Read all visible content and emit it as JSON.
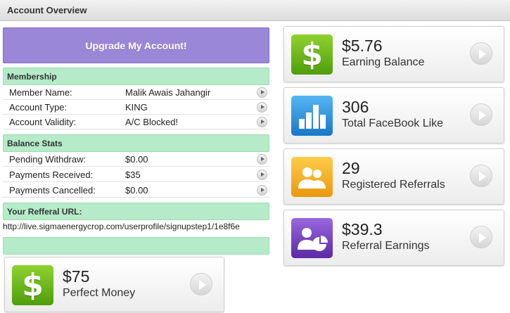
{
  "header": {
    "title": "Account Overview"
  },
  "upgrade_label": "Upgrade My Account!",
  "membership": {
    "heading": "Membership",
    "rows": [
      {
        "key": "Member Name:",
        "value": "Malik Awais Jahangir"
      },
      {
        "key": "Account Type:",
        "value": "KING"
      },
      {
        "key": "Account Validity:",
        "value": "A/C Blocked!"
      }
    ]
  },
  "balance": {
    "heading": "Balance Stats",
    "rows": [
      {
        "key": "Pending Withdraw:",
        "value": "$0.00"
      },
      {
        "key": "Payments Received:",
        "value": "$35"
      },
      {
        "key": "Payments Cancelled:",
        "value": "$0.00"
      }
    ]
  },
  "referral": {
    "heading": "Your Refferal URL:",
    "url": "http://live.sigmaenergycrop.com/userprofile/signupstep1/1e8f6e"
  },
  "perfect_money": {
    "value": "$75",
    "label": "Perfect Money",
    "icon": "dollar-icon"
  },
  "stats": [
    {
      "value": "$5.76",
      "label": "Earning Balance",
      "icon": "dollar-icon"
    },
    {
      "value": "306",
      "label": "Total FaceBook Like",
      "icon": "bar-chart-icon"
    },
    {
      "value": "29",
      "label": "Registered Referrals",
      "icon": "users-icon"
    },
    {
      "value": "$39.3",
      "label": "Referral Earnings",
      "icon": "user-pie-icon"
    }
  ],
  "colors": {
    "upgrade": "#9b87d8",
    "section": "#b5ebc8",
    "green_icon": "#6cbb1e",
    "blue_icon": "#2e94de",
    "orange_icon": "#f4b12a",
    "purple_icon": "#7a46c2"
  }
}
